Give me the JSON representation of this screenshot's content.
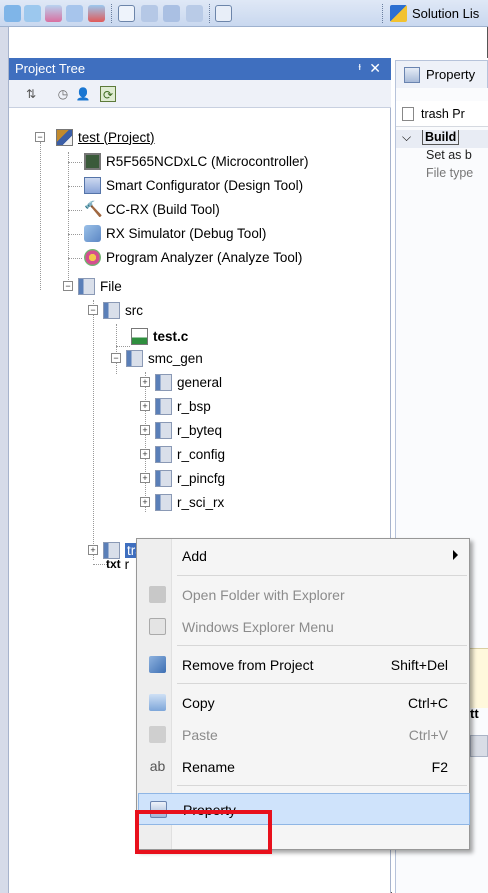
{
  "toolbar": {
    "solution_label": "Solution Lis"
  },
  "project_tree": {
    "title": "Project Tree",
    "pin_icon": "pin-icon",
    "close_glyph": "✕",
    "nodes": {
      "project": "test (Project)",
      "mcu": "R5F565NCDxLC (Microcontroller)",
      "smart": "Smart Configurator (Design Tool)",
      "ccrx": "CC-RX (Build Tool)",
      "rxsim": "RX Simulator (Debug Tool)",
      "pa": "Program Analyzer (Analyze Tool)",
      "file": "File",
      "src": "src",
      "testc": "test.c",
      "smc_gen": "smc_gen",
      "general": "general",
      "r_bsp": "r_bsp",
      "r_byteq": "r_byteq",
      "r_config": "r_config",
      "r_pincfg": "r_pincfg",
      "r_sci_rx": "r_sci_rx",
      "trash": "trash",
      "txt_icon_label": "txt",
      "txt_partial": "r"
    }
  },
  "property_pane": {
    "tab_label": "Property",
    "row_title": "trash Pr",
    "build_label": "Build",
    "setas_label": "Set as b",
    "filetype_label": "File type",
    "right_partial": "tt"
  },
  "context_menu": {
    "add": "Add",
    "open_folder": "Open Folder with Explorer",
    "explorer_menu": "Windows Explorer Menu",
    "remove": "Remove from Project",
    "remove_shortcut": "Shift+Del",
    "copy": "Copy",
    "copy_shortcut": "Ctrl+C",
    "paste": "Paste",
    "paste_shortcut": "Ctrl+V",
    "rename": "Rename",
    "rename_shortcut": "F2",
    "property": "Property"
  },
  "colors": {
    "selection": "#3f6fbf",
    "highlight_box": "#e8101c",
    "menu_hover": "#cfe3fb"
  }
}
